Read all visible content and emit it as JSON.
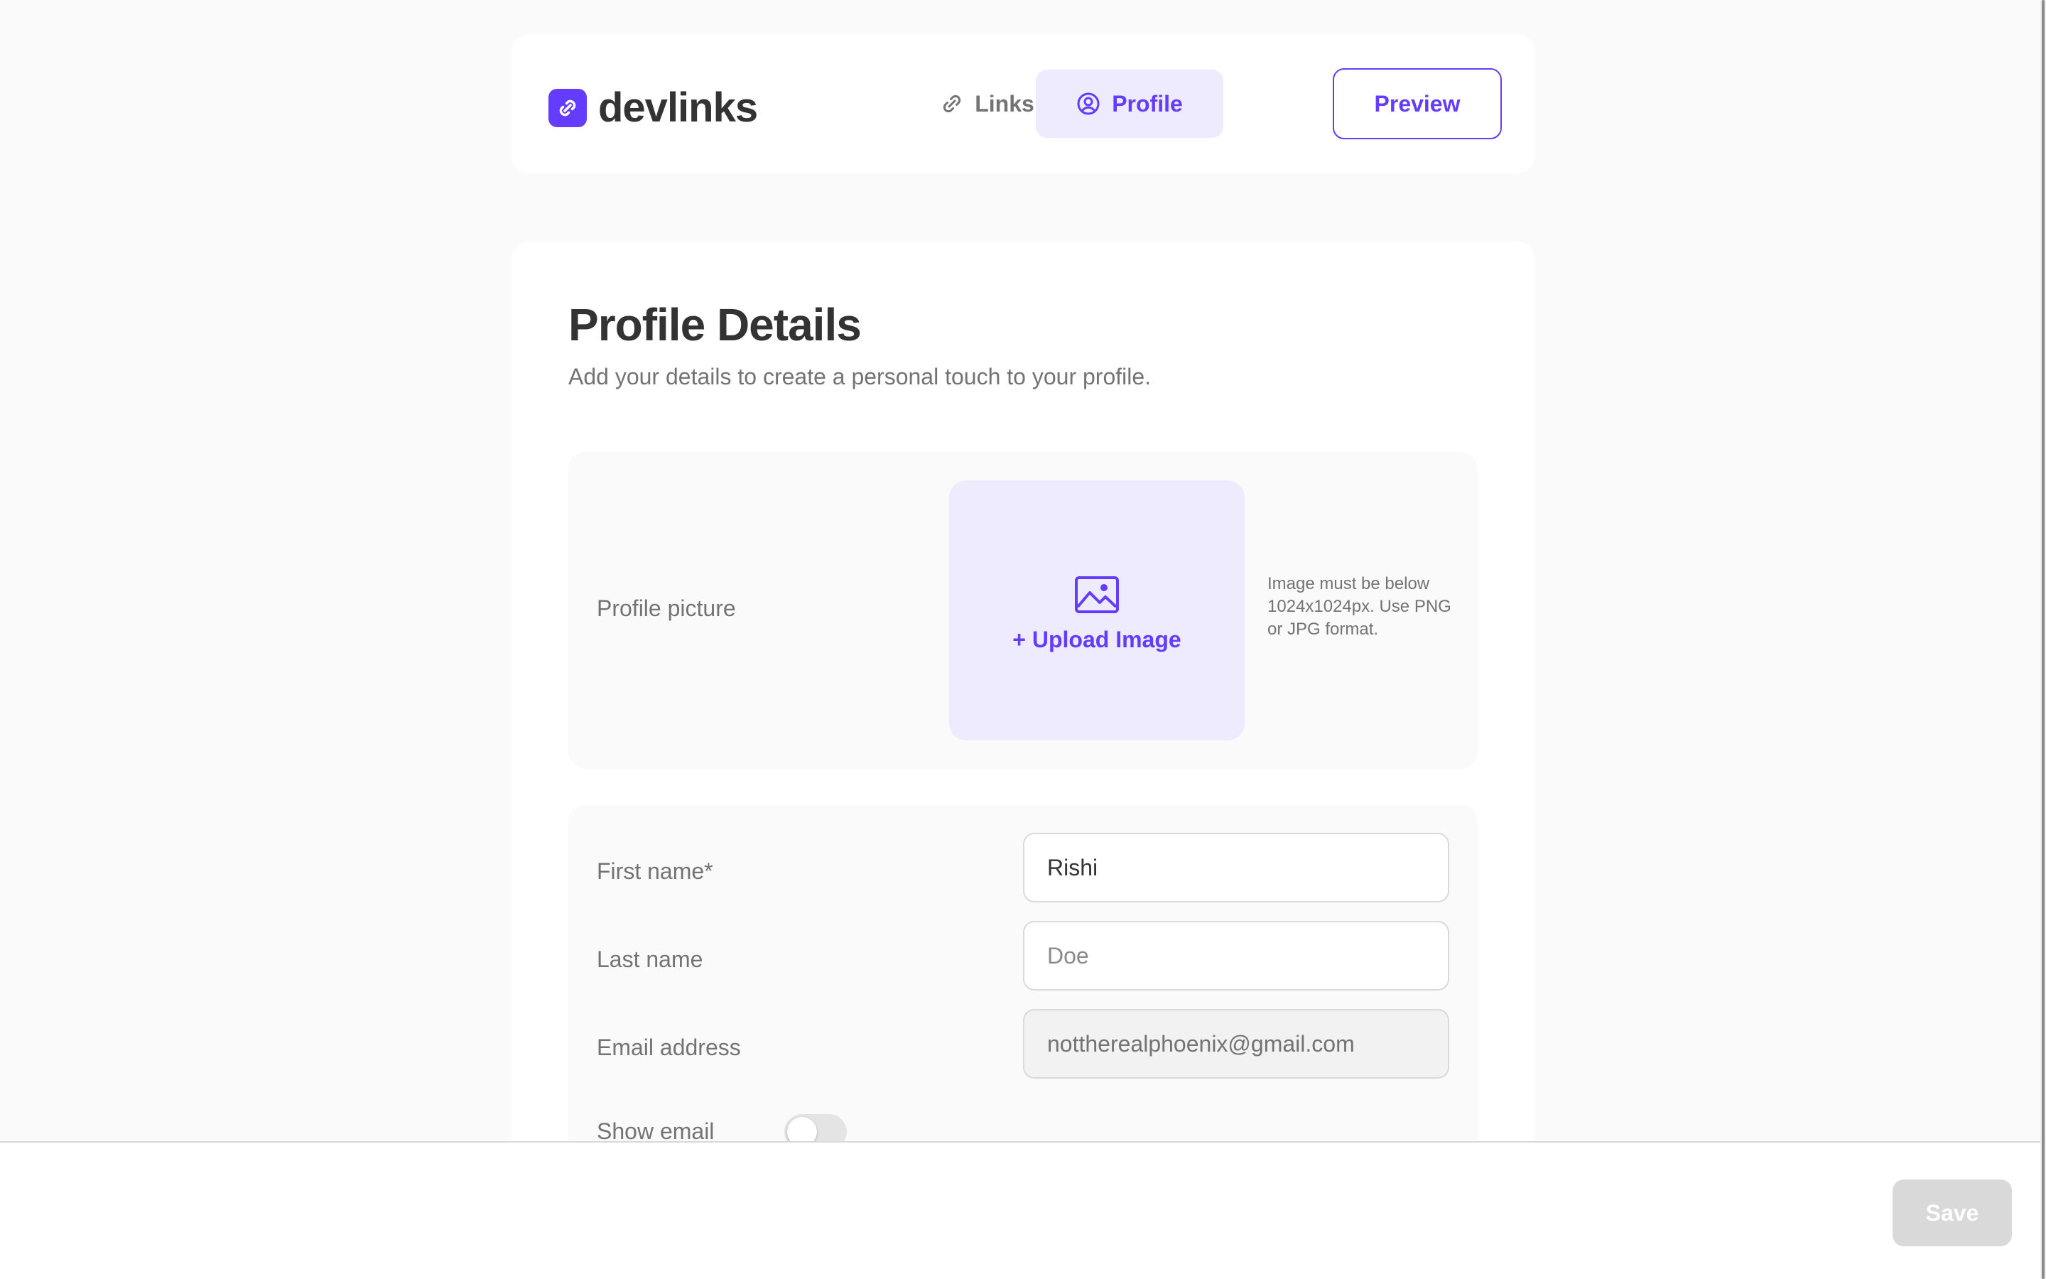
{
  "app": {
    "name": "devlinks",
    "accent_color": "#633cff",
    "accent_light": "#efebff"
  },
  "header": {
    "tabs": [
      {
        "label": "Links",
        "icon": "link-icon",
        "active": false
      },
      {
        "label": "Profile",
        "icon": "user-circle-icon",
        "active": true
      }
    ],
    "preview_label": "Preview"
  },
  "profile": {
    "title": "Profile Details",
    "subtitle": "Add your details to create a personal touch to your profile.",
    "picture": {
      "label": "Profile picture",
      "upload_label": "+ Upload Image",
      "icon": "image-icon",
      "hint": "Image must be below 1024x1024px. Use PNG or JPG format."
    },
    "fields": {
      "first_name": {
        "label": "First name*",
        "value": "Rishi",
        "placeholder": ""
      },
      "last_name": {
        "label": "Last name",
        "value": "",
        "placeholder": "Doe"
      },
      "email": {
        "label": "Email address",
        "value": "nottherealphoenix@gmail.com",
        "disabled": true
      },
      "show_email": {
        "label": "Show email",
        "enabled": false
      }
    }
  },
  "footer": {
    "save_label": "Save",
    "save_enabled": false
  }
}
